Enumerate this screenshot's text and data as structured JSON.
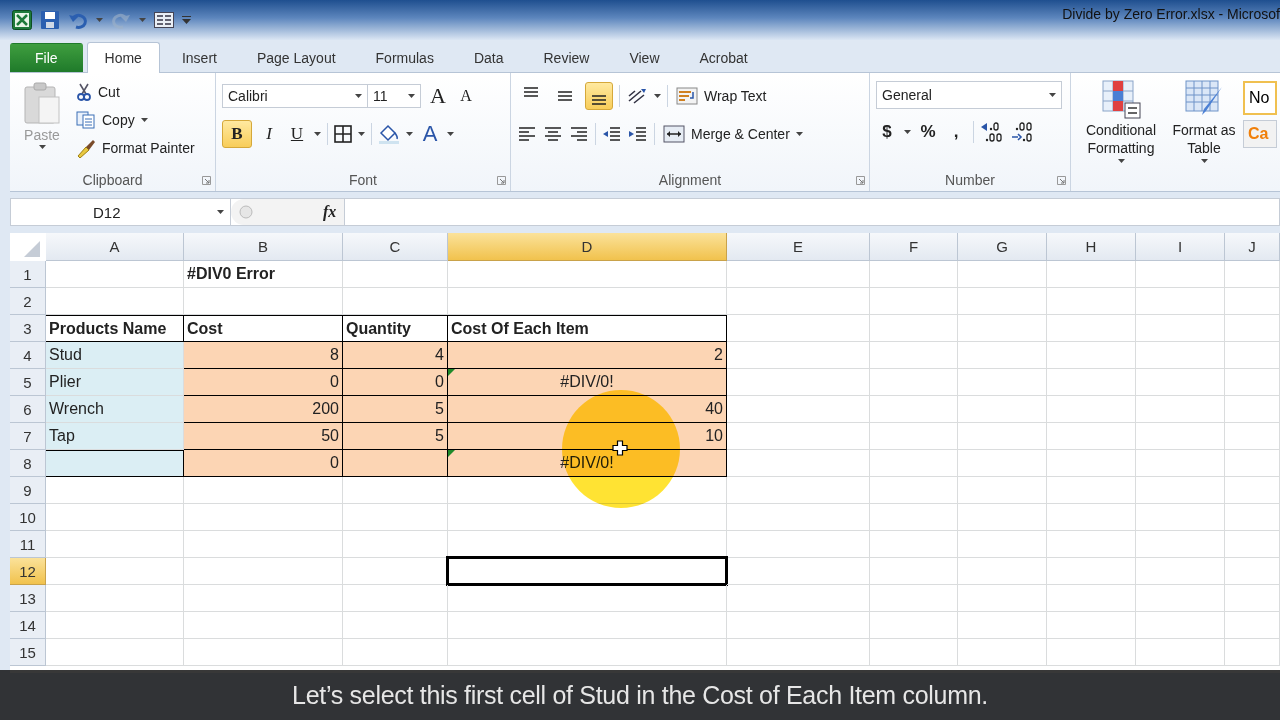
{
  "window": {
    "title": "Divide by Zero Error.xlsx  -  Microsof"
  },
  "quick_access": [
    {
      "kind": "save",
      "disabled": false
    },
    {
      "kind": "undo",
      "disabled": false
    },
    {
      "kind": "redo",
      "disabled": true
    },
    {
      "kind": "form",
      "disabled": false
    }
  ],
  "tabs": [
    {
      "label": "File",
      "kind": "file",
      "selected": false
    },
    {
      "label": "Home",
      "selected": true
    },
    {
      "label": "Insert",
      "selected": false
    },
    {
      "label": "Page Layout",
      "selected": false
    },
    {
      "label": "Formulas",
      "selected": false
    },
    {
      "label": "Data",
      "selected": false
    },
    {
      "label": "Review",
      "selected": false
    },
    {
      "label": "View",
      "selected": false
    },
    {
      "label": "Acrobat",
      "selected": false
    }
  ],
  "ribbon": {
    "clipboard": {
      "label": "Clipboard",
      "paste": {
        "label": "Paste",
        "disabled": true
      },
      "cut": "Cut",
      "copy": "Copy",
      "format_painter": "Format Painter"
    },
    "font": {
      "label": "Font",
      "font_name": "Calibri",
      "font_size": "11",
      "grow": "A",
      "shrink": "A",
      "font_color": "A",
      "styles": [
        {
          "glyph": "B",
          "kind": "bold",
          "on": true
        },
        {
          "glyph": "I",
          "kind": "italic",
          "on": false
        },
        {
          "glyph": "U",
          "kind": "underline",
          "on": false
        }
      ]
    },
    "alignment": {
      "label": "Alignment",
      "vertical": [
        {
          "kind": "top",
          "selected": false
        },
        {
          "kind": "middle",
          "selected": false
        },
        {
          "kind": "bottom",
          "selected": true
        }
      ],
      "wrap_text": "Wrap Text",
      "merge_center": "Merge & Center"
    },
    "number": {
      "label": "Number",
      "format": "General",
      "symbols": [
        "$",
        "%",
        ","
      ]
    },
    "styles": {
      "conditional_formatting": "Conditional Formatting",
      "format_as_table": "Format as Table",
      "cell_styles": [
        {
          "text": "No",
          "color": "#000000"
        },
        {
          "text": "Ca",
          "color": "#f07f09"
        }
      ]
    }
  },
  "formula_bar": {
    "name_box": "D12",
    "fx": "fx"
  },
  "columns": [
    {
      "label": "A",
      "selected": false
    },
    {
      "label": "B",
      "selected": false
    },
    {
      "label": "C",
      "selected": false
    },
    {
      "label": "D",
      "selected": true
    },
    {
      "label": "E",
      "selected": false
    },
    {
      "label": "F",
      "selected": false
    },
    {
      "label": "G",
      "selected": false
    },
    {
      "label": "H",
      "selected": false
    },
    {
      "label": "I",
      "selected": false
    },
    {
      "label": "J",
      "selected": false
    }
  ],
  "rows": [
    {
      "number": "1",
      "selected": false,
      "cells": [
        null,
        {
          "text": "#DIV0 Error",
          "kind": "header"
        }
      ]
    },
    {
      "number": "2",
      "selected": false
    },
    {
      "number": "3",
      "selected": false,
      "cells": [
        {
          "text": "Products Name",
          "kind": "header",
          "bordered": true
        },
        {
          "text": "Cost",
          "kind": "header",
          "bordered": true
        },
        {
          "text": "Quantity",
          "kind": "header",
          "bordered": true
        },
        {
          "text": "Cost Of Each Item",
          "kind": "header",
          "bordered": true
        }
      ]
    },
    {
      "number": "4",
      "selected": false,
      "cells": [
        {
          "text": "Stud",
          "kind": "text",
          "color": "#dbeef4"
        },
        {
          "text": "8",
          "kind": "number",
          "color": "#fcd5b4",
          "bordered": true
        },
        {
          "text": "4",
          "kind": "number",
          "color": "#fcd5b4",
          "bordered": true
        },
        {
          "text": "2",
          "kind": "number",
          "color": "#fcd5b4",
          "bordered": true
        }
      ]
    },
    {
      "number": "5",
      "selected": false,
      "cells": [
        {
          "text": "Plier",
          "kind": "text",
          "color": "#dbeef4"
        },
        {
          "text": "0",
          "kind": "number",
          "color": "#fcd5b4",
          "bordered": true
        },
        {
          "text": "0",
          "kind": "number",
          "color": "#fcd5b4",
          "bordered": true
        },
        {
          "text": "#DIV/0!",
          "kind": "error",
          "color": "#fcd5b4",
          "bordered": true,
          "error_flag": true
        }
      ]
    },
    {
      "number": "6",
      "selected": false,
      "cells": [
        {
          "text": "Wrench",
          "kind": "text",
          "color": "#dbeef4"
        },
        {
          "text": "200",
          "kind": "number",
          "color": "#fcd5b4",
          "bordered": true
        },
        {
          "text": "5",
          "kind": "number",
          "color": "#fcd5b4",
          "bordered": true
        },
        {
          "text": "40",
          "kind": "number",
          "color": "#fcd5b4",
          "bordered": true
        }
      ]
    },
    {
      "number": "7",
      "selected": false,
      "cells": [
        {
          "text": "Tap",
          "kind": "text",
          "color": "#dbeef4"
        },
        {
          "text": "50",
          "kind": "number",
          "color": "#fcd5b4",
          "bordered": true
        },
        {
          "text": "5",
          "kind": "number",
          "color": "#fcd5b4",
          "bordered": true
        },
        {
          "text": "10",
          "kind": "number",
          "color": "#fcd5b4",
          "bordered": true
        }
      ]
    },
    {
      "number": "8",
      "selected": false,
      "cells": [
        {
          "kind": "text",
          "color": "#dbeef4",
          "bordered": true
        },
        {
          "text": "0",
          "kind": "number",
          "color": "#fcd5b4",
          "bordered": true
        },
        {
          "kind": "number",
          "color": "#fcd5b4",
          "bordered": true
        },
        {
          "text": "#DIV/0!",
          "kind": "error",
          "color": "#fcd5b4",
          "bordered": true,
          "error_flag": true
        }
      ]
    },
    {
      "number": "9",
      "selected": false
    },
    {
      "number": "10",
      "selected": false
    },
    {
      "number": "11",
      "selected": false
    },
    {
      "number": "12",
      "selected": true
    },
    {
      "number": "13",
      "selected": false
    },
    {
      "number": "14",
      "selected": false
    },
    {
      "number": "15",
      "selected": false
    }
  ],
  "caption": "Let’s select this first cell of Stud in the Cost of Each Item column."
}
